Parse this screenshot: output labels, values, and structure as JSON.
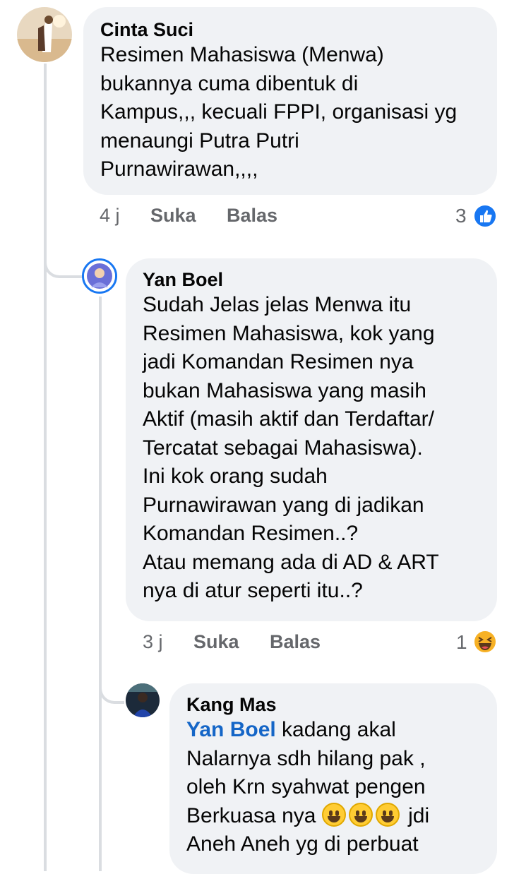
{
  "comments": [
    {
      "author": "Cinta Suci",
      "text": "Resimen Mahasiswa (Menwa)\nbukannya cuma dibentuk di\nKampus,,,  kecuali FPPI, organisasi yg\nmenaungi Putra Putri\nPurnawirawan,,,,",
      "time": "4 j",
      "like_label": "Suka",
      "reply_label": "Balas",
      "reaction_count": "3",
      "reaction_icon": "like-icon",
      "reaction_color": "#1877f2"
    },
    {
      "author": "Yan Boel",
      "text": "Sudah Jelas jelas Menwa itu\nResimen Mahasiswa, kok yang\njadi Komandan Resimen nya\nbukan Mahasiswa yang masih\nAktif (masih aktif dan Terdaftar/\nTercatat sebagai Mahasiswa).\nIni kok orang sudah\nPurnawirawan yang di jadikan\nKomandan Resimen..?\nAtau memang ada di AD & ART\nnya di atur seperti itu..?",
      "time": "3 j",
      "like_label": "Suka",
      "reply_label": "Balas",
      "reaction_count": "1",
      "reaction_icon": "haha-icon",
      "reaction_color": "#f7b125"
    },
    {
      "author": "Kang Mas",
      "mention": "Yan Boel",
      "text_line1": " kadang akal",
      "text_mid": "Nalarnya sdh hilang pak ,\n oleh Krn syahwat  pengen\nBerkuasa nya ",
      "text_after_emoji": "  jdi",
      "text_end": "Aneh Aneh yg di perbuat",
      "emoji_icon": "grinning-face-icon"
    }
  ]
}
